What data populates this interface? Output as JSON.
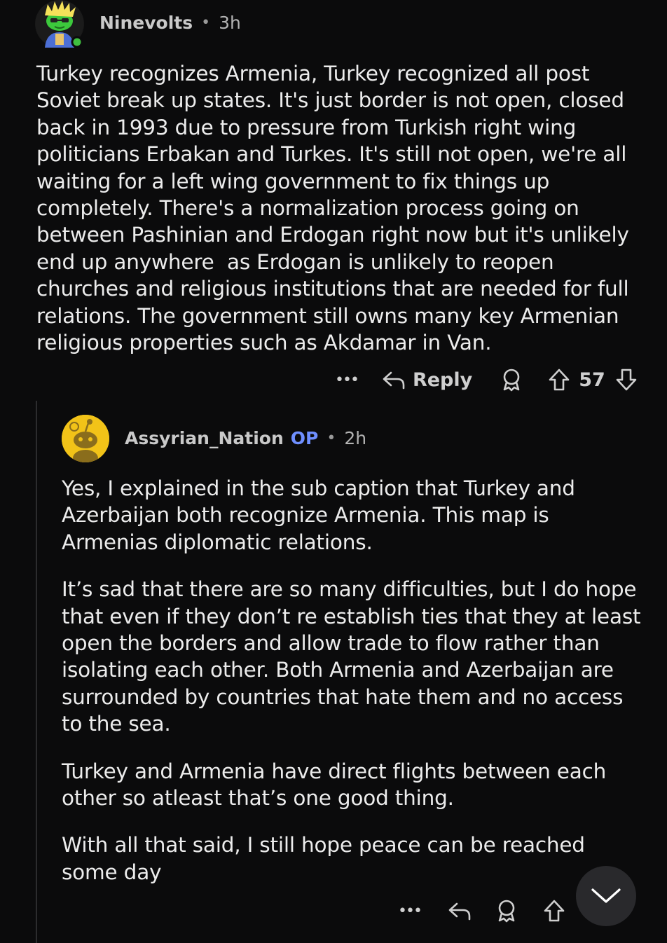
{
  "comment": {
    "author": "Ninevolts",
    "separator": "•",
    "time": "3h",
    "avatar_icon": "snoo-avatar-green-icon",
    "online_status_color": "#3fbf3f",
    "lines": [
      "Turkey recognizes Armenia, Turkey recognized all post",
      "Soviet break up states. It's just border is not open, closed",
      "back in 1993 due to pressure from Turkish right wing",
      "politicians Erbakan and Turkes. It's still not open, we're all",
      "waiting for a left wing government to fix things up",
      "completely. There's a normalization process going on",
      "between Pashinian and Erdogan right now but it's unlikely",
      "end up anywhere  as Erdogan is unlikely to reopen",
      "churches and religious institutions that are needed for full",
      "relations. The government still owns many key Armenian",
      "religious properties such as Akdamar in Van."
    ],
    "actions": {
      "more": "•••",
      "reply": "Reply",
      "score": "57"
    }
  },
  "reply": {
    "author": "Assyrian_Nation",
    "op_badge": "OP",
    "separator": "•",
    "time": "2h",
    "avatar_icon": "snoo-avatar-yellow-icon",
    "paragraphs": [
      [
        "Yes, I explained in the sub caption that Turkey and",
        "Azerbaijan both recognize Armenia. This map is",
        "Armenias diplomatic relations."
      ],
      [
        "It’s sad that there are so many difficulties, but I do hope",
        "that even if they don’t re establish ties that they at least",
        "open the borders and allow trade to flow rather than",
        "isolating each other. Both Armenia and Azerbaijan are",
        "surrounded by countries that hate them and no access",
        "to the sea."
      ],
      [
        "Turkey and Armenia have direct flights between each",
        "other so atleast that’s one good thing."
      ],
      [
        "With all that said, I still hope peace can be reached",
        "some day"
      ]
    ],
    "actions": {
      "more": "•••"
    }
  },
  "colors": {
    "background": "#0b0b0c",
    "text": "#ececec",
    "op_accent": "#6f8fff",
    "fab": "#29292c"
  }
}
